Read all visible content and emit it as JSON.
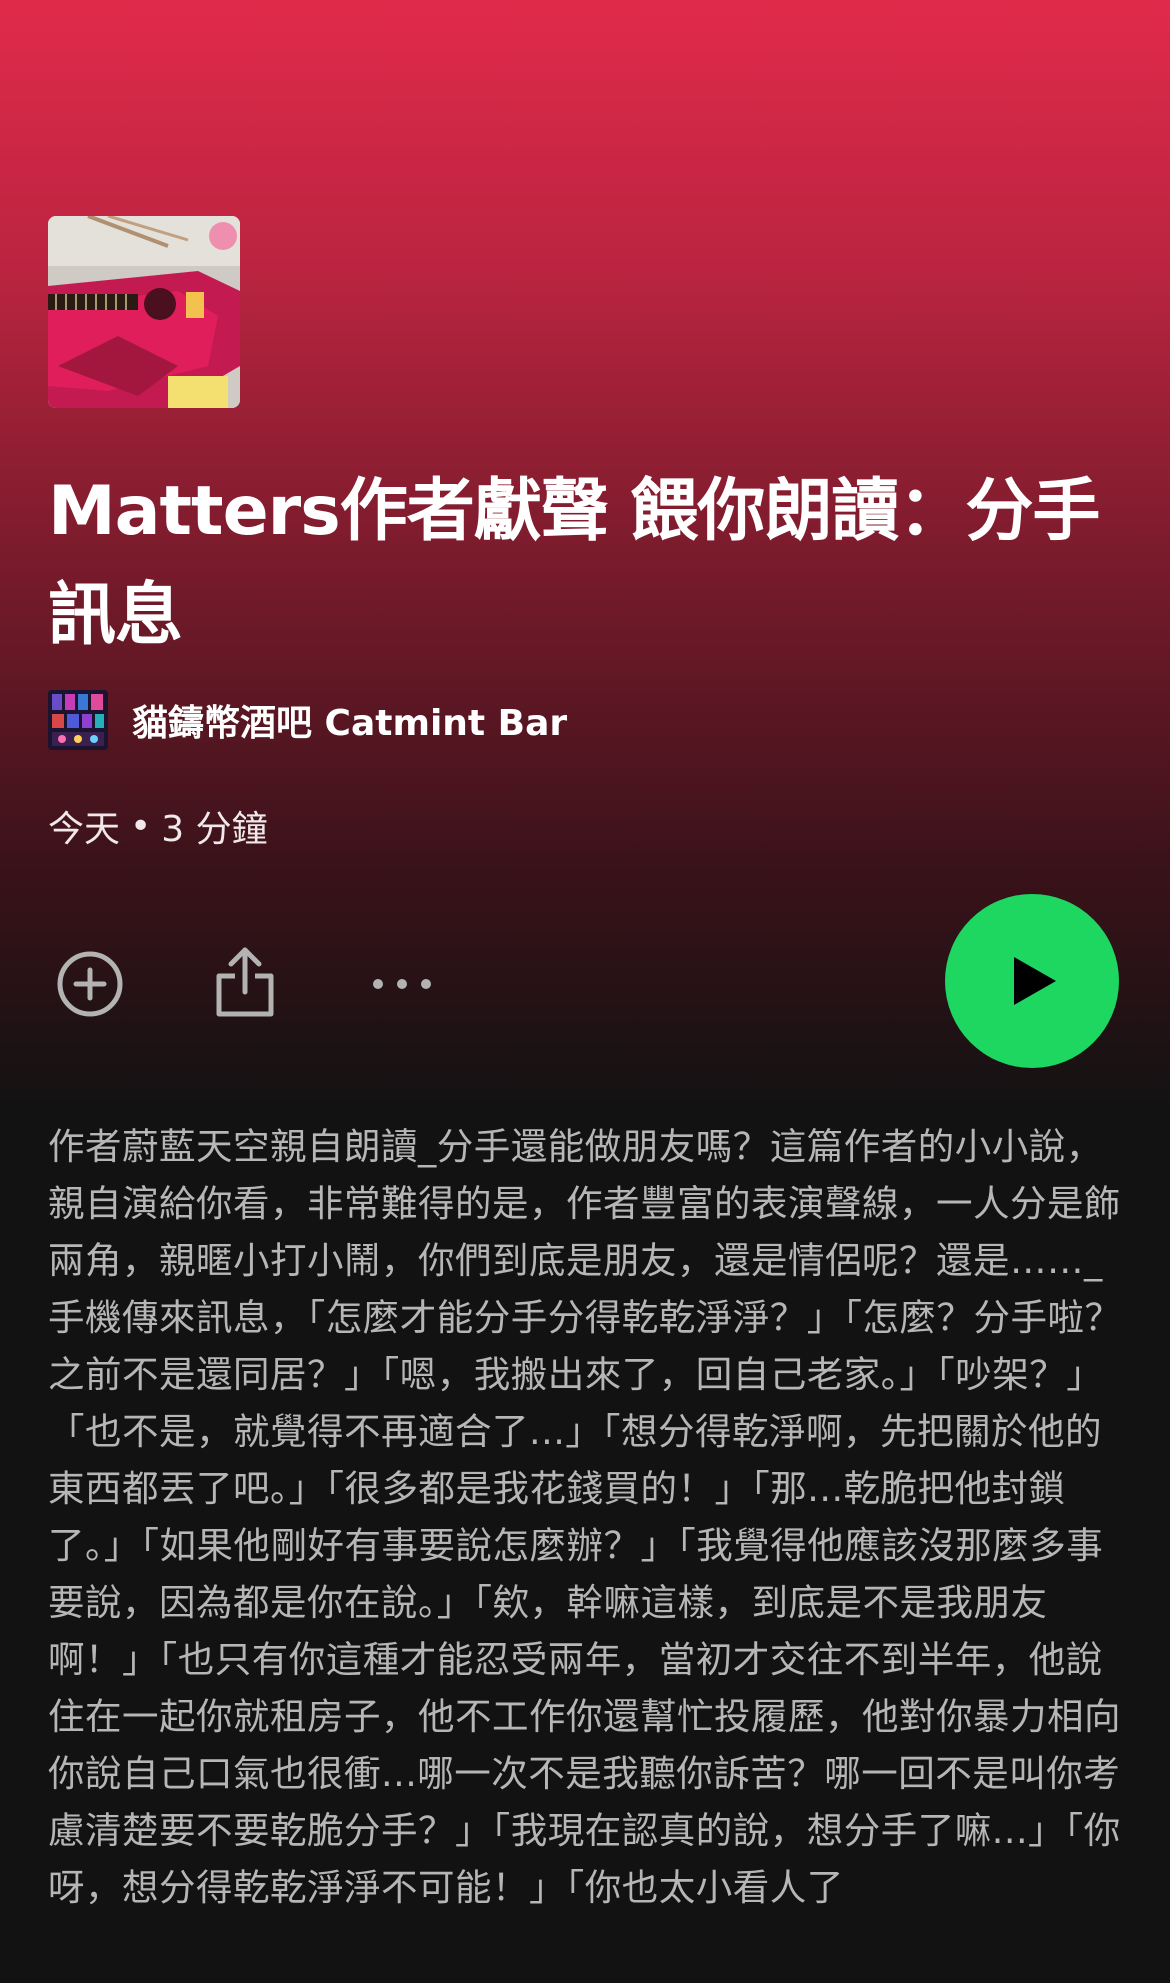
{
  "episode": {
    "title": "Matters作者獻聲 餵你朗讀：分手訊息",
    "author": "貓鑄幣酒吧 Catmint Bar",
    "date": "今天",
    "separator": "•",
    "duration": "3 分鐘",
    "description": "作者蔚藍天空親自朗讀_分手還能做朋友嗎？這篇作者的小小說，親自演給你看，非常難得的是，作者豐富的表演聲線，一人分是飾兩角，親暱小打小鬧，你們到底是朋友，還是情侶呢？還是……_手機傳來訊息，「怎麼才能分手分得乾乾淨淨？」「怎麼？分手啦？之前不是還同居？」「嗯，我搬出來了，回自己老家。」「吵架？」「也不是，就覺得不再適合了...」「想分得乾淨啊，先把關於他的東西都丟了吧。」「很多都是我花錢買的！」「那...乾脆把他封鎖了。」「如果他剛好有事要說怎麼辦？」「我覺得他應該沒那麼多事要說，因為都是你在說。」「欸，幹嘛這樣，到底是不是我朋友啊！」「也只有你這種才能忍受兩年，當初才交往不到半年，他說住在一起你就租房子，他不工作你還幫忙投履歷，他對你暴力相向你說自己口氣也很衝...哪一次不是我聽你訴苦？哪一回不是叫你考慮清楚要不要乾脆分手？」「我現在認真的說，想分手了嘛...」「你呀，想分得乾乾淨淨不可能！」「你也太小看人了"
  },
  "icons": {
    "cover": "ukulele-cover-art",
    "avatar": "catmint-bar-avatar",
    "add": "add-circle-icon",
    "share": "share-icon",
    "more": "more-dots-icon",
    "play": "play-icon"
  },
  "colors": {
    "accent": "#1ed760",
    "hero_top": "#e12a4b",
    "background": "#121212"
  }
}
